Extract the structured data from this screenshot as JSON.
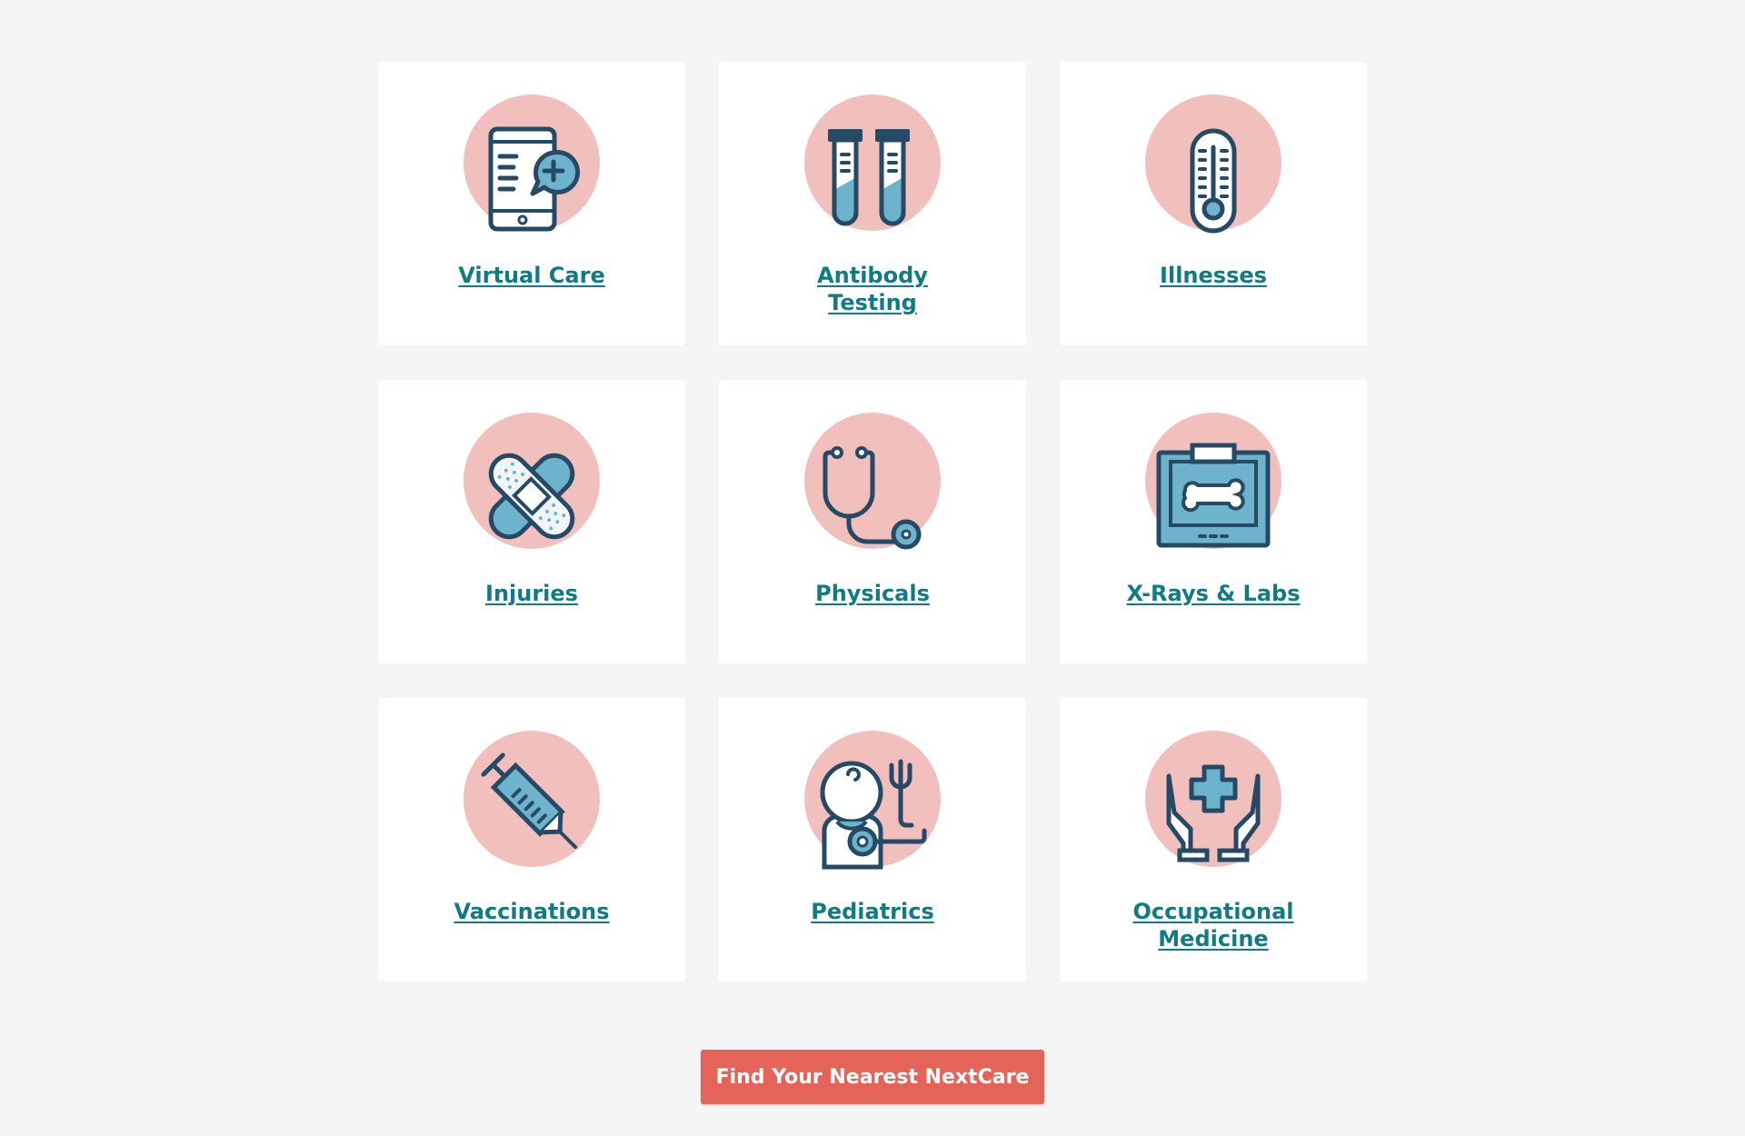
{
  "colors": {
    "page_background": "#f5f5f5",
    "card_background": "#ffffff",
    "icon_circle": "#f2c0bc",
    "icon_stroke": "#264a66",
    "icon_fill": "#6db3cc",
    "link": "#127a82",
    "cta_background": "#e5645a",
    "cta_text": "#ffffff"
  },
  "services": [
    {
      "label": "Virtual Care",
      "icon": "phone-chat-icon"
    },
    {
      "label": "Antibody Testing",
      "icon": "test-tubes-icon"
    },
    {
      "label": "Illnesses",
      "icon": "thermometer-icon"
    },
    {
      "label": "Injuries",
      "icon": "bandage-icon"
    },
    {
      "label": "Physicals",
      "icon": "stethoscope-icon"
    },
    {
      "label": "X-Rays & Labs",
      "icon": "xray-icon"
    },
    {
      "label": "Vaccinations",
      "icon": "syringe-icon"
    },
    {
      "label": "Pediatrics",
      "icon": "baby-icon"
    },
    {
      "label": "Occupational Medicine",
      "icon": "hands-cross-icon"
    }
  ],
  "cta": {
    "label": "Find Your Nearest NextCare"
  }
}
